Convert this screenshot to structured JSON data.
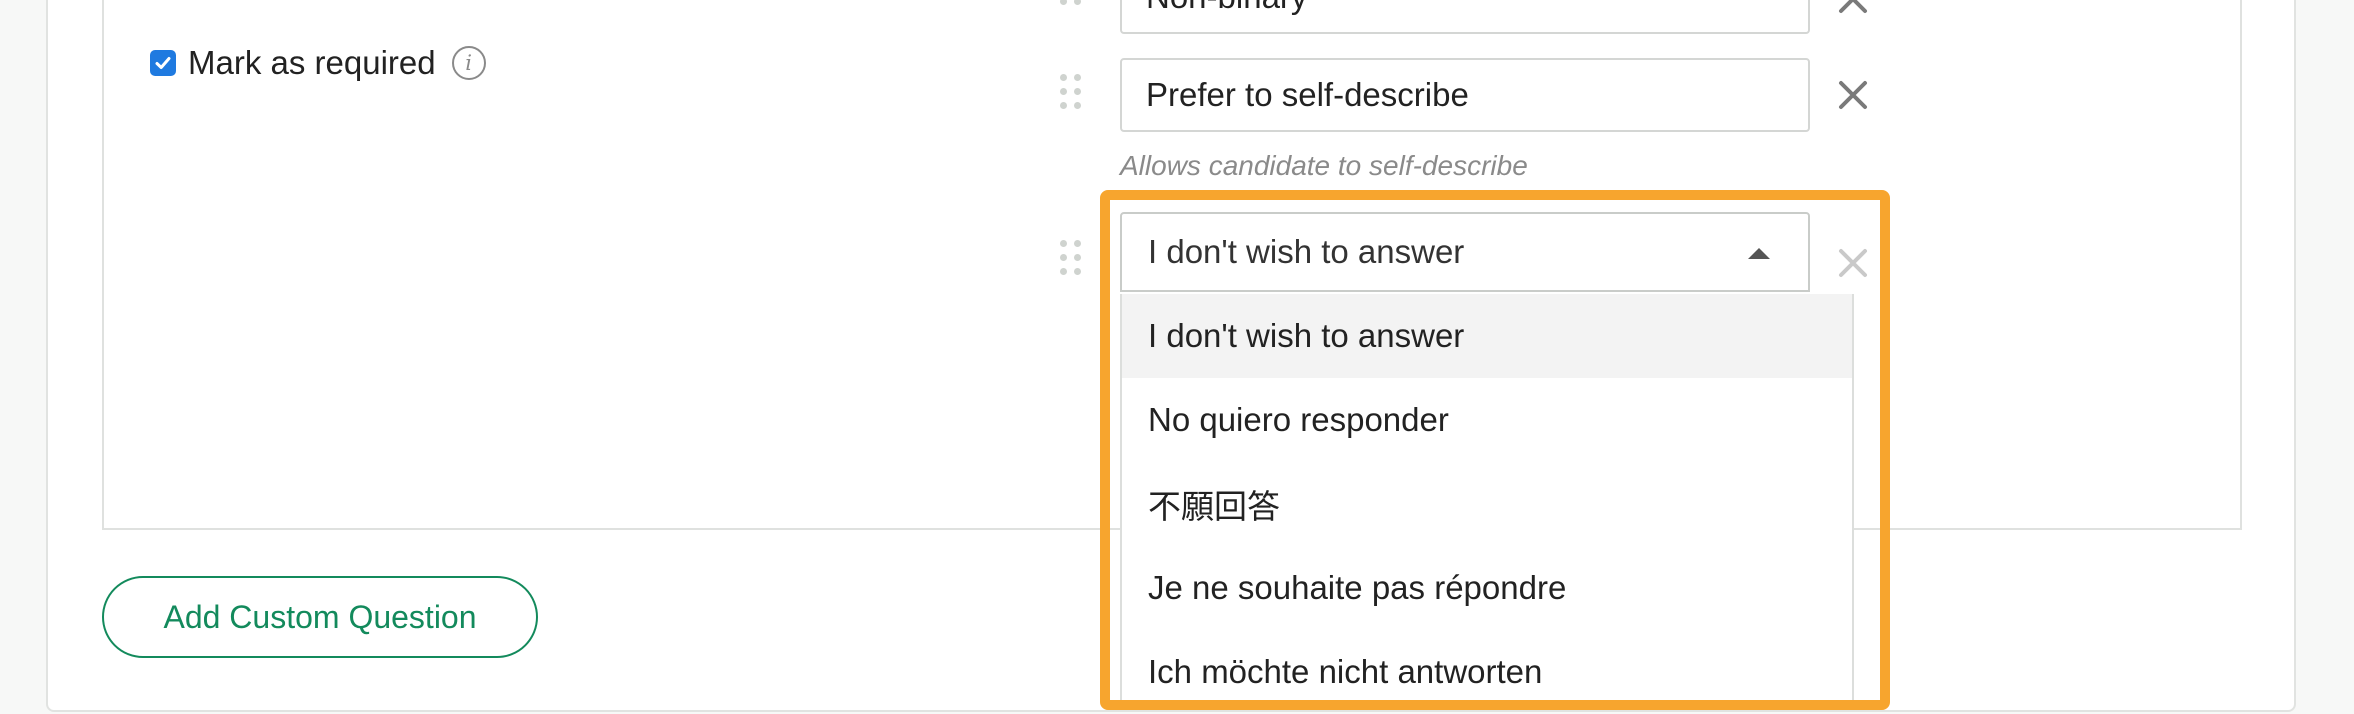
{
  "required": {
    "label": "Mark as required",
    "checked": true,
    "info_icon": "info-icon",
    "info_glyph": "i"
  },
  "answer_options": [
    {
      "value": "Non-binary",
      "remove_icon": "close-icon",
      "drag_icon": "drag-handle-icon"
    },
    {
      "value": "Prefer to self-describe",
      "remove_icon": "close-icon",
      "drag_icon": "drag-handle-icon",
      "hint": "Allows candidate to self-describe"
    }
  ],
  "decline_option": {
    "selected": "I don't wish to answer",
    "dropdown_icon": "caret-up-icon",
    "remove_icon": "close-icon",
    "options": [
      "I don't wish to answer",
      "No quiero responder",
      "不願回答",
      "Je ne souhaite pas répondre",
      "Ich möchte nicht antworten"
    ],
    "highlighted_index": 0
  },
  "add_button": {
    "label": "Add Custom Question"
  },
  "colors": {
    "accent_green": "#138a5c",
    "highlight_orange": "#f7a52e",
    "checkbox_blue": "#1f7ae0"
  }
}
